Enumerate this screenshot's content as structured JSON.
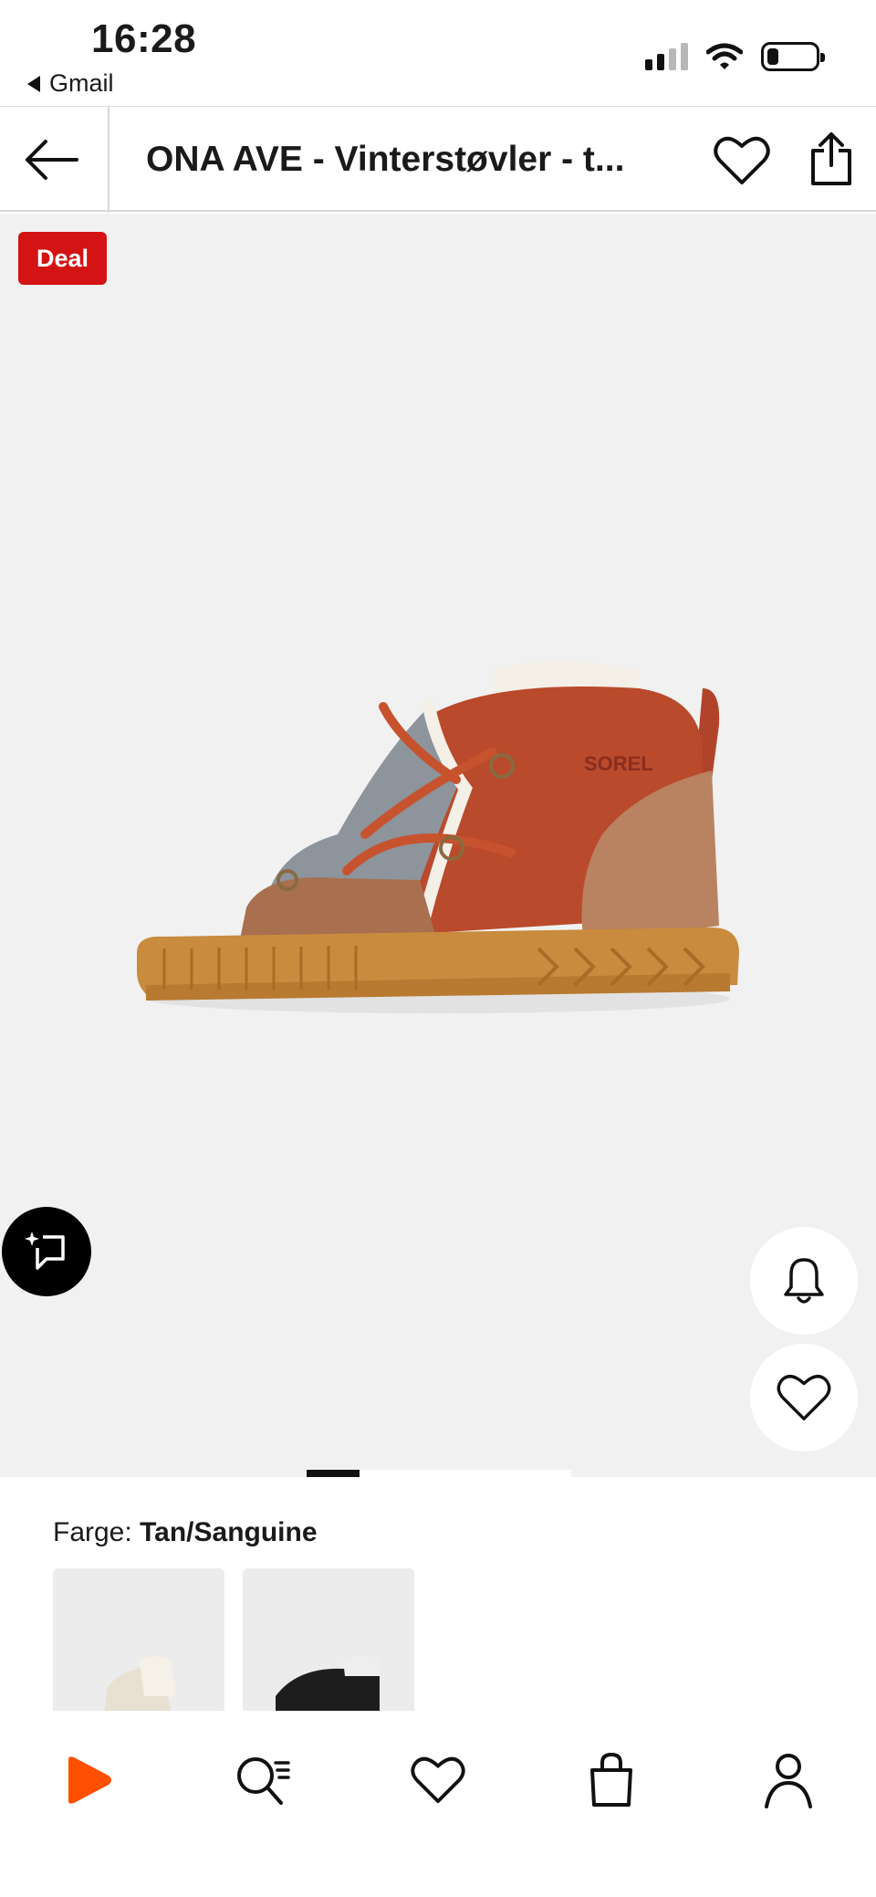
{
  "status_bar": {
    "time": "16:28",
    "back_app": "Gmail"
  },
  "header": {
    "title": "ONA AVE - Vinterstøvler - t..."
  },
  "gallery": {
    "badge": "Deal",
    "image_count": 5,
    "active_index": 0
  },
  "color_section": {
    "label": "Farge:",
    "value": "Tan/Sanguine"
  },
  "colors": {
    "accent_red": "#d41414",
    "brand_orange": "#ff4f00"
  },
  "icons": {
    "back": "arrow-left-icon",
    "favorite": "heart-icon",
    "share": "share-icon",
    "ai": "ai-sparkle-icon",
    "bell": "bell-icon",
    "home": "play-logo-icon",
    "search": "search-icon",
    "wishlist": "heart-icon",
    "bag": "bag-icon",
    "profile": "user-icon"
  }
}
